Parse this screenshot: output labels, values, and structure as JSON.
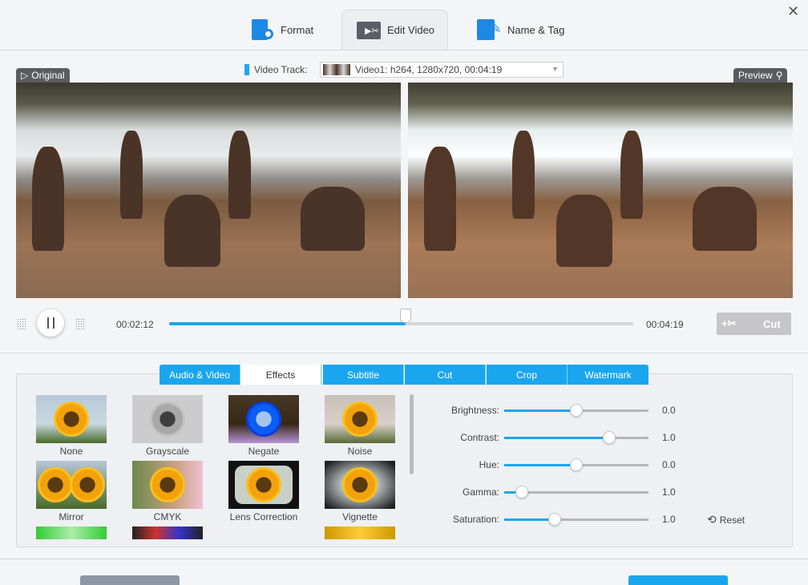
{
  "tabs": [
    {
      "label": "Format",
      "icon": "format-icon"
    },
    {
      "label": "Edit Video",
      "icon": "edit-video-icon",
      "active": true
    },
    {
      "label": "Name & Tag",
      "icon": "name-tag-icon"
    }
  ],
  "video_track": {
    "label": "Video Track:",
    "value": "Video1: h264, 1280x720, 00:04:19"
  },
  "original_label": "Original",
  "preview_label": "Preview",
  "playback": {
    "current": "00:02:12",
    "total": "00:04:19",
    "progress": 0.51,
    "cut_label": "Cut",
    "state": "playing"
  },
  "edit_tabs": [
    "Audio & Video",
    "Effects",
    "Subtitle",
    "Cut",
    "Crop",
    "Watermark"
  ],
  "active_edit_tab": "Effects",
  "effects": [
    "None",
    "Grayscale",
    "Negate",
    "Noise",
    "Mirror",
    "CMYK",
    "Lens Correction",
    "Vignette"
  ],
  "sliders": [
    {
      "label": "Brightness:",
      "value": "0.0",
      "level": 0.5
    },
    {
      "label": "Contrast:",
      "value": "1.0",
      "level": 0.73
    },
    {
      "label": "Hue:",
      "value": "0.0",
      "level": 0.5
    },
    {
      "label": "Gamma:",
      "value": "1.0",
      "level": 0.12
    },
    {
      "label": "Saturation:",
      "value": "1.0",
      "level": 0.35
    }
  ],
  "reset_label": "Reset",
  "colors": {
    "accent": "#1aa6ef"
  }
}
